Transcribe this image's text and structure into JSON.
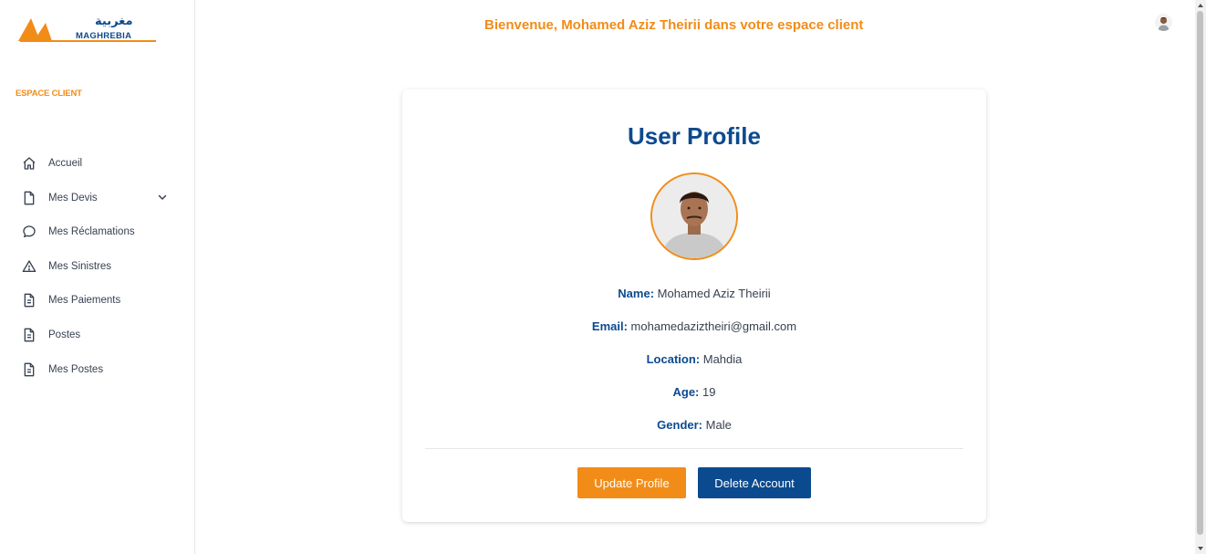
{
  "brand": {
    "name": "MAGHREBIA",
    "arabic": "مغربية",
    "primary": "#0b4a8f",
    "accent": "#f28c18"
  },
  "sidebar": {
    "section_label": "ESPACE CLIENT",
    "items": [
      {
        "label": "Accueil",
        "icon": "home-icon"
      },
      {
        "label": "Mes Devis",
        "icon": "file-icon",
        "has_submenu": true
      },
      {
        "label": "Mes Réclamations",
        "icon": "chat-icon"
      },
      {
        "label": "Mes Sinistres",
        "icon": "warning-icon"
      },
      {
        "label": "Mes Paiements",
        "icon": "document-icon"
      },
      {
        "label": "Postes",
        "icon": "document-icon"
      },
      {
        "label": "Mes Postes",
        "icon": "document-icon"
      }
    ]
  },
  "header": {
    "welcome": "Bienvenue, Mohamed Aziz Theirii dans votre espace client"
  },
  "profile": {
    "title": "User Profile",
    "fields": [
      {
        "key": "Name:",
        "value": "Mohamed Aziz Theirii"
      },
      {
        "key": "Email:",
        "value": "mohamedaziztheiri@gmail.com"
      },
      {
        "key": "Location:",
        "value": "Mahdia"
      },
      {
        "key": "Age:",
        "value": "19"
      },
      {
        "key": "Gender:",
        "value": "Male"
      }
    ],
    "update_label": "Update Profile",
    "delete_label": "Delete Account"
  }
}
